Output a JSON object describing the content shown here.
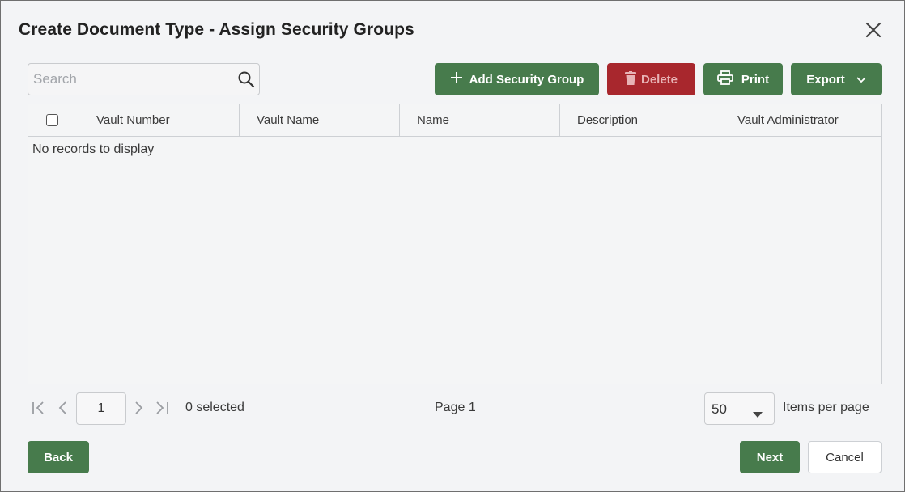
{
  "dialog": {
    "title": "Create Document Type - Assign Security Groups"
  },
  "toolbar": {
    "search_placeholder": "Search",
    "add_label": "Add Security Group",
    "delete_label": "Delete",
    "print_label": "Print",
    "export_label": "Export"
  },
  "grid": {
    "columns": [
      "Vault Number",
      "Vault Name",
      "Name",
      "Description",
      "Vault Administrator"
    ],
    "empty_message": "No records to display"
  },
  "pager": {
    "current_page": "1",
    "selected_text": "0 selected",
    "page_text": "Page 1",
    "per_page_value": "50",
    "per_page_label": "Items per page"
  },
  "footer": {
    "back_label": "Back",
    "next_label": "Next",
    "cancel_label": "Cancel"
  },
  "colors": {
    "primary_green": "#477b4c",
    "danger_red": "#a8272d",
    "background": "#f3f4f6"
  }
}
